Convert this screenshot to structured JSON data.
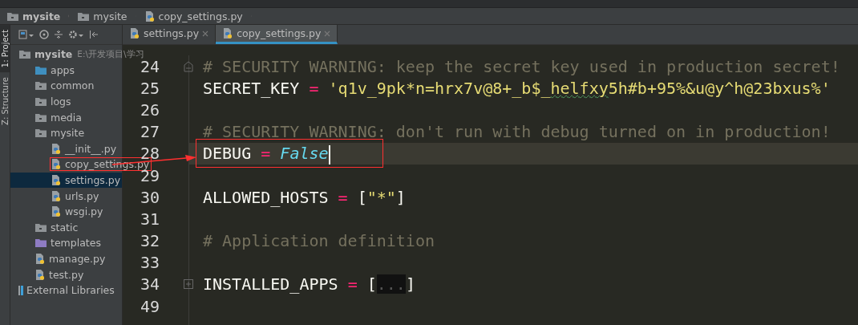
{
  "breadcrumbs": [
    {
      "label": "mysite",
      "kind": "folder",
      "bold": true
    },
    {
      "label": "mysite",
      "kind": "folder",
      "bold": false
    },
    {
      "label": "copy_settings.py",
      "kind": "python",
      "bold": false
    }
  ],
  "side_tabs": [
    {
      "label": "1: Project",
      "selected": true
    },
    {
      "label": "Z: Structure",
      "selected": false
    }
  ],
  "tabs": [
    {
      "label": "settings.py",
      "selected": false
    },
    {
      "label": "copy_settings.py",
      "selected": true
    }
  ],
  "project_tree": [
    {
      "label": "mysite",
      "path": "E:\\开发项目\\学习",
      "kind": "module",
      "selected": false,
      "marked": false,
      "children": [
        {
          "label": "apps",
          "kind": "source_folder",
          "selected": false,
          "marked": false
        },
        {
          "label": "common",
          "kind": "folder",
          "selected": false,
          "marked": false
        },
        {
          "label": "logs",
          "kind": "folder",
          "selected": false,
          "marked": false
        },
        {
          "label": "media",
          "kind": "folder",
          "selected": false,
          "marked": false
        },
        {
          "label": "mysite",
          "kind": "folder",
          "selected": false,
          "marked": false,
          "children": [
            {
              "label": "__init__.py",
              "kind": "python",
              "selected": false,
              "marked": false
            },
            {
              "label": "copy_settings.py",
              "kind": "python",
              "selected": false,
              "marked": true
            },
            {
              "label": "settings.py",
              "kind": "python",
              "selected": true,
              "marked": false
            },
            {
              "label": "urls.py",
              "kind": "python",
              "selected": false,
              "marked": false
            },
            {
              "label": "wsgi.py",
              "kind": "python",
              "selected": false,
              "marked": false
            }
          ]
        },
        {
          "label": "static",
          "kind": "folder",
          "selected": false,
          "marked": false
        },
        {
          "label": "templates",
          "kind": "template_folder",
          "selected": false,
          "marked": false
        },
        {
          "label": "manage.py",
          "kind": "python",
          "selected": false,
          "marked": false
        },
        {
          "label": "test.py",
          "kind": "python",
          "selected": false,
          "marked": false
        }
      ]
    },
    {
      "label": "External Libraries",
      "kind": "library",
      "selected": false,
      "marked": false
    }
  ],
  "code_lines": [
    {
      "number": "24",
      "foldable": true,
      "current": false,
      "marked": false,
      "tokens": [
        {
          "kind": "comment",
          "text": "# SECURITY WARNING: keep the secret key used in production secret!"
        }
      ]
    },
    {
      "number": "25",
      "current": false,
      "marked": false,
      "tokens": [
        {
          "kind": "name",
          "text": "SECRET_KEY "
        },
        {
          "kind": "operator",
          "text": "= "
        },
        {
          "kind": "string",
          "text": "'q1v_9pk*n=hrx7v@8+_b$_"
        },
        {
          "kind": "typo",
          "text": "helfxy"
        },
        {
          "kind": "string",
          "text": "5h#b+95%&u@y^h@23bxus%'"
        }
      ]
    },
    {
      "number": "26",
      "current": false,
      "marked": false
    },
    {
      "number": "27",
      "current": false,
      "marked": false,
      "tokens": [
        {
          "kind": "comment",
          "text": "# SECURITY WARNING: don't run with debug turned on in production!"
        }
      ]
    },
    {
      "number": "28",
      "current": true,
      "marked": true,
      "tokens": [
        {
          "kind": "name",
          "text": "DEBUG "
        },
        {
          "kind": "operator",
          "text": "= "
        },
        {
          "kind": "constant",
          "text": "False"
        }
      ]
    },
    {
      "number": "29",
      "current": false,
      "marked": false
    },
    {
      "number": "30",
      "current": false,
      "marked": false,
      "tokens": [
        {
          "kind": "name",
          "text": "ALLOWED_HOSTS "
        },
        {
          "kind": "operator",
          "text": "= "
        },
        {
          "kind": "name",
          "text": "["
        },
        {
          "kind": "string",
          "text": "\"*\""
        },
        {
          "kind": "name",
          "text": "]"
        }
      ]
    },
    {
      "number": "31",
      "current": false,
      "marked": false
    },
    {
      "number": "32",
      "current": false,
      "marked": false,
      "tokens": [
        {
          "kind": "comment",
          "text": "# Application definition"
        }
      ]
    },
    {
      "number": "33",
      "current": false,
      "marked": false
    },
    {
      "number": "34",
      "collapsed": true,
      "current": false,
      "marked": false,
      "tokens": [
        {
          "kind": "name",
          "text": "INSTALLED_APPS "
        },
        {
          "kind": "operator",
          "text": "= "
        },
        {
          "kind": "name",
          "text": "["
        },
        {
          "kind": "folded",
          "text": "..."
        },
        {
          "kind": "name",
          "text": "]"
        }
      ]
    },
    {
      "number": "49",
      "current": false,
      "marked": false
    }
  ]
}
